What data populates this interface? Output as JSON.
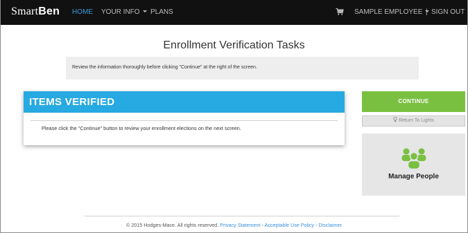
{
  "nav": {
    "brand_main": "Smart",
    "brand_bold": "Ben",
    "home": "HOME",
    "your_info": "YOUR INFO",
    "plans": "PLANS",
    "user": "SAMPLE EMPLOYEE",
    "separator": "|",
    "sign_out": "SIGN OUT"
  },
  "page": {
    "title": "Enrollment Verification Tasks",
    "info_text": "Review the information thoroughly before clicking \"Continue\" at the right of the screen."
  },
  "panel": {
    "header": "ITEMS VERIFIED",
    "message": "Please click the \"Continue\" button to review your enrollment elections on the next screen."
  },
  "sidebar": {
    "continue_label": "CONTINUE",
    "return_label": "Return To Lights",
    "manage_label": "Manage People"
  },
  "footer": {
    "copyright": "© 2015 Hodges-Mace. All rights reserved.",
    "privacy": "Privacy Statement",
    "dash1": "-",
    "acceptable_use": "Acceptable Use Policy",
    "dash2": "-",
    "disclaimer": "Disclaimer"
  },
  "colors": {
    "navbar": "#111111",
    "active_link": "#3b9ad9",
    "panel_header": "#27a9e1",
    "continue_button": "#79c041",
    "people_icon": "#79c041"
  }
}
